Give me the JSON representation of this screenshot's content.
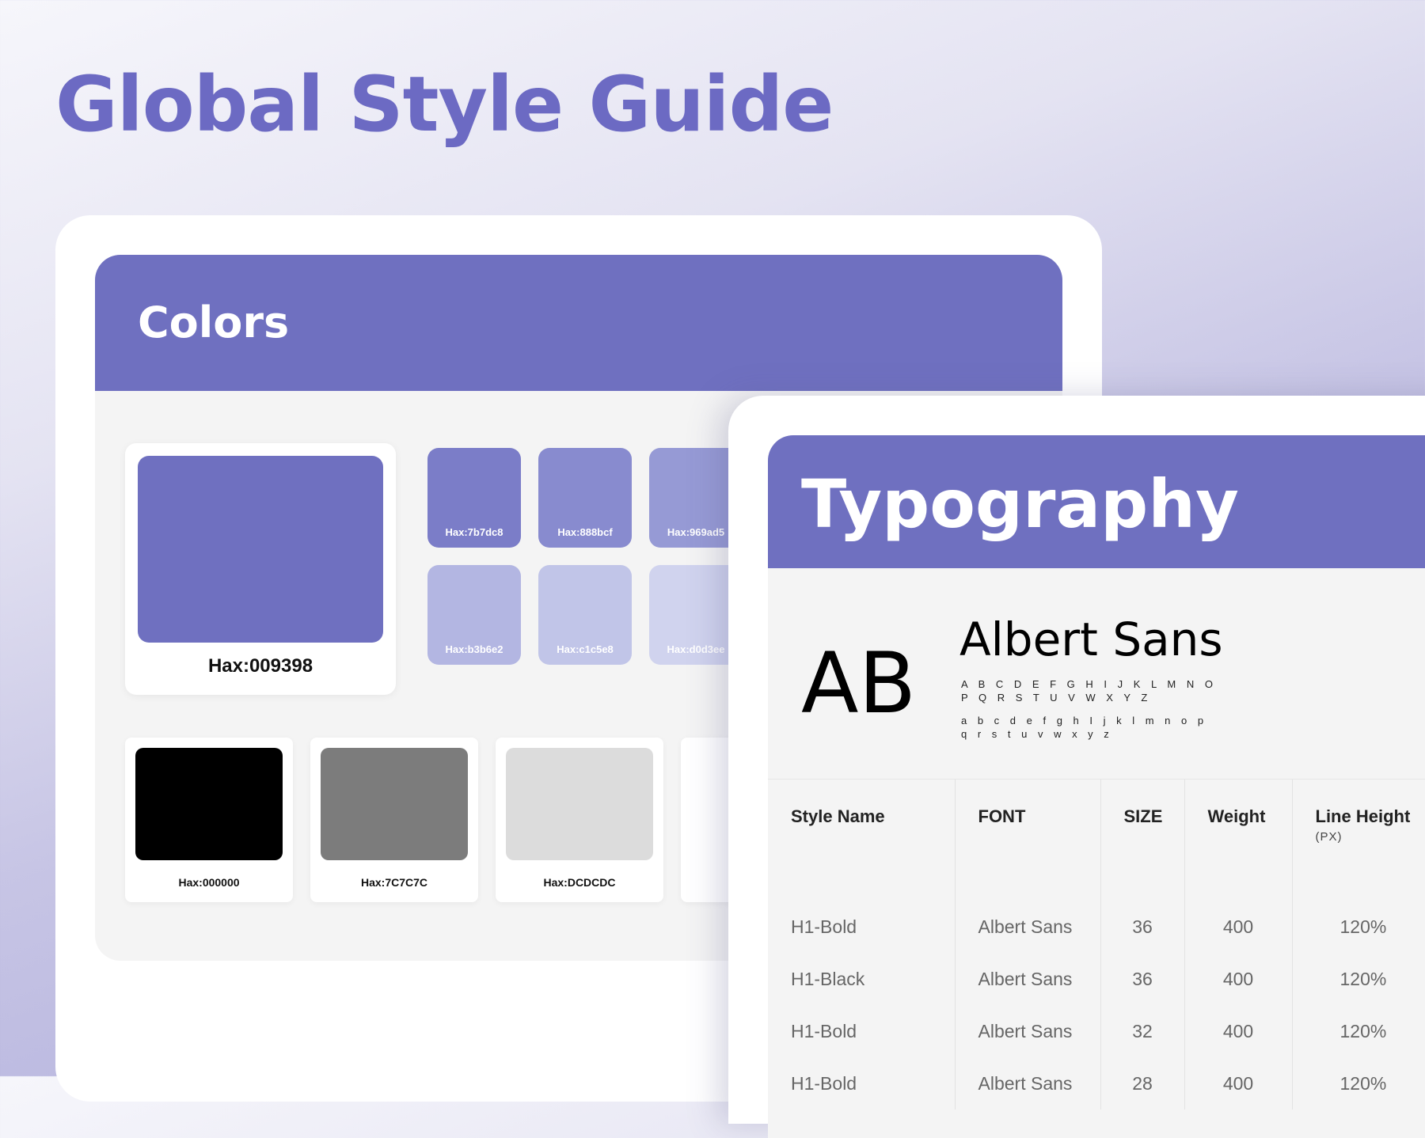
{
  "page": {
    "title": "Global Style Guide"
  },
  "colors": {
    "title": "Colors",
    "primary": {
      "label": "Hax:009398",
      "hex": "#6f70c0"
    },
    "tints": [
      {
        "label": "Hax:7b7dc8",
        "hex": "#7b7dc8"
      },
      {
        "label": "Hax:888bcf",
        "hex": "#888bcf"
      },
      {
        "label": "Hax:969ad5",
        "hex": "#969ad5"
      },
      {
        "label": "Hax:b3b6e2",
        "hex": "#b3b6e2"
      },
      {
        "label": "Hax:c1c5e8",
        "hex": "#c1c5e8"
      },
      {
        "label": "Hax:d0d3ee",
        "hex": "#d0d3ee"
      }
    ],
    "neutrals": [
      {
        "label": "Hax:000000",
        "hex": "#000000"
      },
      {
        "label": "Hax:7C7C7C",
        "hex": "#7c7c7c"
      },
      {
        "label": "Hax:DCDCDC",
        "hex": "#dcdcdc"
      }
    ]
  },
  "typography": {
    "title": "Typography",
    "specimen": "AB",
    "font_name": "Albert Sans",
    "uppercase": "A B C D E F G H I J K L M N O P Q R S T U V W X Y Z",
    "lowercase": "a b c d e f g h I j k l m n o p q r s t u v w x y z",
    "table": {
      "headers": {
        "style_name": "Style Name",
        "font": "FONT",
        "size": "SIZE",
        "weight": "Weight",
        "line_height": "Line Height",
        "line_height_unit": "(PX)"
      },
      "rows": [
        {
          "style_name": "H1-Bold",
          "font": "Albert Sans",
          "size": "36",
          "weight": "400",
          "line_height": "120%"
        },
        {
          "style_name": "H1-Black",
          "font": "Albert Sans",
          "size": "36",
          "weight": "400",
          "line_height": "120%"
        },
        {
          "style_name": "H1-Bold",
          "font": "Albert Sans",
          "size": "32",
          "weight": "400",
          "line_height": "120%"
        },
        {
          "style_name": "H1-Bold",
          "font": "Albert Sans",
          "size": "28",
          "weight": "400",
          "line_height": "120%"
        }
      ]
    }
  }
}
